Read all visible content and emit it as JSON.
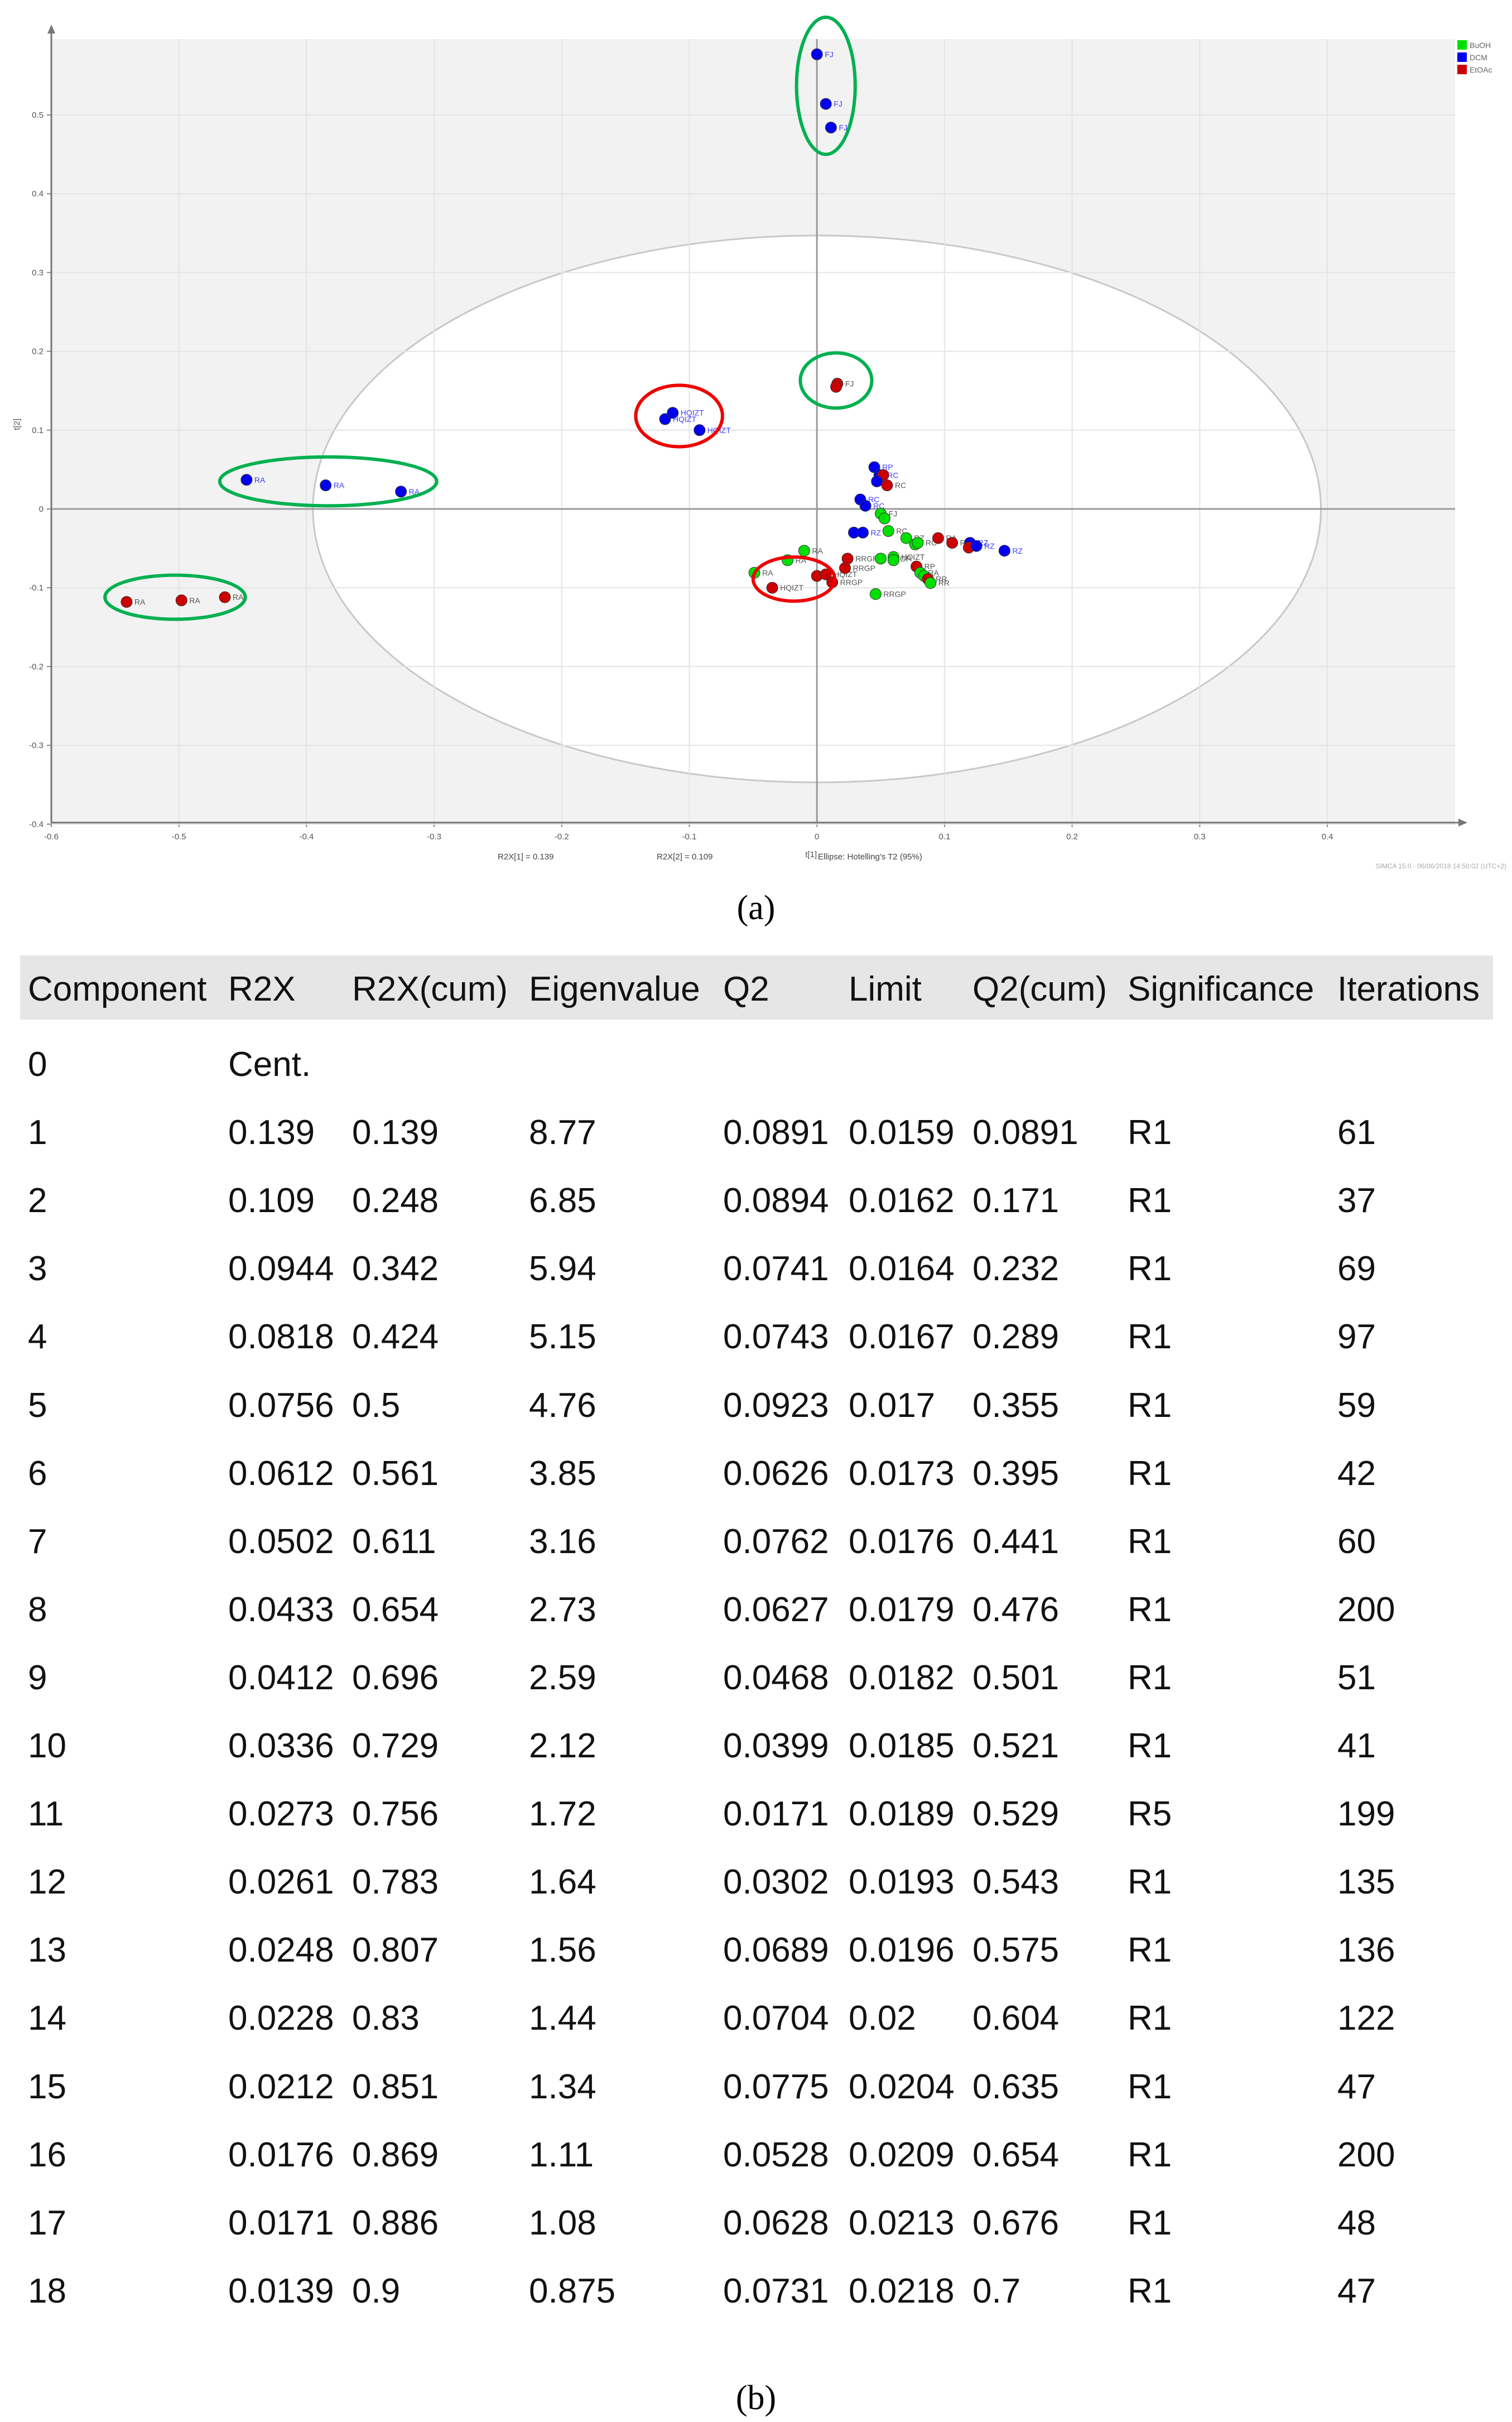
{
  "chart_data": {
    "type": "scatter",
    "title": "",
    "xlabel": "t[1]",
    "ylabel": "t[2]",
    "xlim": [
      -0.6,
      0.5
    ],
    "ylim": [
      -0.4,
      0.6
    ],
    "xticks": [
      -0.6,
      -0.5,
      -0.4,
      -0.3,
      -0.2,
      -0.1,
      0,
      0.1,
      0.2,
      0.3,
      0.4
    ],
    "xtick_labels": [
      "-0.6",
      "-0.5",
      "-0.4",
      "-0.3",
      "-0.2",
      "-0.1",
      "0",
      "0.1",
      "0.2",
      "0.3",
      "0.4"
    ],
    "yticks": [
      -0.4,
      -0.3,
      -0.2,
      -0.1,
      0,
      0.1,
      0.2,
      0.3,
      0.4,
      0.5
    ],
    "ytick_labels": [
      "-0.4",
      "-0.3",
      "-0.2",
      "-0.1",
      "0",
      "0.1",
      "0.2",
      "0.3",
      "0.4",
      "0.5"
    ],
    "grid": true,
    "legend_position": "top-right",
    "legend": [
      {
        "name": "BuOH",
        "color": "#00e000"
      },
      {
        "name": "DCM",
        "color": "#0000ee"
      },
      {
        "name": "EtOAc",
        "color": "#cc0000"
      }
    ],
    "hotelling_ellipse": {
      "cx": 0,
      "cy": 0,
      "rx": 0.395,
      "ry": 0.347
    },
    "annotation_ellipses": [
      {
        "cx": 0.007,
        "cy": 0.537,
        "rx": 0.023,
        "ry": 0.087,
        "color": "#00b050"
      },
      {
        "cx": -0.383,
        "cy": 0.035,
        "rx": 0.085,
        "ry": 0.031,
        "color": "#00b050"
      },
      {
        "cx": -0.503,
        "cy": -0.112,
        "rx": 0.055,
        "ry": 0.028,
        "color": "#00b050"
      },
      {
        "cx": -0.108,
        "cy": 0.118,
        "rx": 0.034,
        "ry": 0.039,
        "color": "#ee0000"
      },
      {
        "cx": 0.015,
        "cy": 0.163,
        "rx": 0.028,
        "ry": 0.035,
        "color": "#00b050"
      },
      {
        "cx": -0.018,
        "cy": -0.089,
        "rx": 0.032,
        "ry": 0.028,
        "color": "#ee0000"
      }
    ],
    "points": [
      {
        "x": 0.0,
        "y": 0.577,
        "g": "DCM",
        "label": "FJ"
      },
      {
        "x": 0.007,
        "y": 0.514,
        "g": "DCM",
        "label": "FJ"
      },
      {
        "x": 0.011,
        "y": 0.484,
        "g": "DCM",
        "label": "FJ"
      },
      {
        "x": -0.447,
        "y": 0.037,
        "g": "DCM",
        "label": "RA"
      },
      {
        "x": -0.385,
        "y": 0.03,
        "g": "DCM",
        "label": "RA"
      },
      {
        "x": -0.326,
        "y": 0.022,
        "g": "DCM",
        "label": "RA"
      },
      {
        "x": -0.541,
        "y": -0.118,
        "g": "EtOAc",
        "label": "RA"
      },
      {
        "x": -0.498,
        "y": -0.116,
        "g": "EtOAc",
        "label": "RA"
      },
      {
        "x": -0.464,
        "y": -0.112,
        "g": "EtOAc",
        "label": "RA"
      },
      {
        "x": -0.119,
        "y": 0.114,
        "g": "DCM",
        "label": "HQIZT"
      },
      {
        "x": -0.113,
        "y": 0.122,
        "g": "DCM",
        "label": "HQIZT"
      },
      {
        "x": -0.092,
        "y": 0.1,
        "g": "DCM",
        "label": "HQIZT"
      },
      {
        "x": 0.016,
        "y": 0.159,
        "g": "EtOAc",
        "label": "FJ"
      },
      {
        "x": 0.015,
        "y": 0.155,
        "g": "EtOAc",
        "label": ""
      },
      {
        "x": 0.045,
        "y": 0.053,
        "g": "DCM",
        "label": "RP"
      },
      {
        "x": 0.049,
        "y": 0.043,
        "g": "DCM",
        "label": "RC"
      },
      {
        "x": 0.052,
        "y": 0.043,
        "g": "EtOAc",
        "label": ""
      },
      {
        "x": 0.047,
        "y": 0.035,
        "g": "DCM",
        "label": ""
      },
      {
        "x": 0.055,
        "y": 0.03,
        "g": "EtOAc",
        "label": "RC"
      },
      {
        "x": 0.034,
        "y": 0.012,
        "g": "DCM",
        "label": "RC"
      },
      {
        "x": 0.038,
        "y": 0.004,
        "g": "DCM",
        "label": "RC"
      },
      {
        "x": 0.05,
        "y": -0.006,
        "g": "BuOH",
        "label": "FJ"
      },
      {
        "x": 0.053,
        "y": -0.012,
        "g": "BuOH",
        "label": ""
      },
      {
        "x": 0.029,
        "y": -0.03,
        "g": "DCM",
        "label": ""
      },
      {
        "x": 0.036,
        "y": -0.03,
        "g": "DCM",
        "label": "RZ"
      },
      {
        "x": 0.056,
        "y": -0.028,
        "g": "BuOH",
        "label": "RC"
      },
      {
        "x": 0.07,
        "y": -0.037,
        "g": "BuOH",
        "label": "RZ"
      },
      {
        "x": 0.077,
        "y": -0.045,
        "g": "BuOH",
        "label": ""
      },
      {
        "x": 0.079,
        "y": -0.043,
        "g": "BuOH",
        "label": "RC"
      },
      {
        "x": 0.095,
        "y": -0.037,
        "g": "EtOAc",
        "label": "RA"
      },
      {
        "x": 0.106,
        "y": -0.043,
        "g": "EtOAc",
        "label": "RZ"
      },
      {
        "x": 0.12,
        "y": -0.043,
        "g": "DCM",
        "label": "RZ"
      },
      {
        "x": 0.119,
        "y": -0.049,
        "g": "EtOAc",
        "label": ""
      },
      {
        "x": 0.125,
        "y": -0.047,
        "g": "DCM",
        "label": "RZ"
      },
      {
        "x": 0.147,
        "y": -0.053,
        "g": "DCM",
        "label": "RZ"
      },
      {
        "x": -0.01,
        "y": -0.053,
        "g": "BuOH",
        "label": "RA"
      },
      {
        "x": -0.023,
        "y": -0.065,
        "g": "BuOH",
        "label": "RA"
      },
      {
        "x": -0.049,
        "y": -0.081,
        "g": "BuOH",
        "label": "RA"
      },
      {
        "x": -0.035,
        "y": -0.1,
        "g": "EtOAc",
        "label": "HQIZT"
      },
      {
        "x": 0.0,
        "y": -0.085,
        "g": "EtOAc",
        "label": ""
      },
      {
        "x": 0.007,
        "y": -0.083,
        "g": "EtOAc",
        "label": "HQIZT"
      },
      {
        "x": 0.012,
        "y": -0.093,
        "g": "EtOAc",
        "label": "RRGP"
      },
      {
        "x": 0.022,
        "y": -0.075,
        "g": "EtOAc",
        "label": "RRGP"
      },
      {
        "x": 0.024,
        "y": -0.063,
        "g": "EtOAc",
        "label": "RRGP"
      },
      {
        "x": 0.05,
        "y": -0.063,
        "g": "BuOH",
        "label": "RRGP"
      },
      {
        "x": 0.06,
        "y": -0.061,
        "g": "BuOH",
        "label": "HQIZT"
      },
      {
        "x": 0.06,
        "y": -0.065,
        "g": "BuOH",
        "label": ""
      },
      {
        "x": 0.078,
        "y": -0.073,
        "g": "EtOAc",
        "label": "RP"
      },
      {
        "x": 0.081,
        "y": -0.081,
        "g": "BuOH",
        "label": "RA"
      },
      {
        "x": 0.084,
        "y": -0.085,
        "g": "BuOH",
        "label": ""
      },
      {
        "x": 0.087,
        "y": -0.089,
        "g": "EtOAc",
        "label": "RR"
      },
      {
        "x": 0.089,
        "y": -0.094,
        "g": "BuOH",
        "label": "RR"
      },
      {
        "x": 0.046,
        "y": -0.108,
        "g": "BuOH",
        "label": "RRGP"
      }
    ],
    "footer": {
      "r2x1": "R2X[1] = 0.139",
      "r2x2": "R2X[2] = 0.109",
      "ellipse": "Ellipse: Hotelling's T2 (95%)",
      "software": "SIMCA 15.0 - 06/06/2018 14:50:02 (UTC+2)"
    }
  },
  "captions": {
    "a": "(a)",
    "b": "(b)"
  },
  "table": {
    "columns": [
      "Component",
      "R2X",
      "R2X(cum)",
      "Eigenvalue",
      "Q2",
      "Limit",
      "Q2(cum)",
      "Significance",
      "Iterations"
    ],
    "rows": [
      [
        "0",
        "Cent.",
        "",
        "",
        "",
        "",
        "",
        "",
        ""
      ],
      [
        "1",
        "0.139",
        "0.139",
        "8.77",
        "0.0891",
        "0.0159",
        "0.0891",
        "R1",
        "61"
      ],
      [
        "2",
        "0.109",
        "0.248",
        "6.85",
        "0.0894",
        "0.0162",
        "0.171",
        "R1",
        "37"
      ],
      [
        "3",
        "0.0944",
        "0.342",
        "5.94",
        "0.0741",
        "0.0164",
        "0.232",
        "R1",
        "69"
      ],
      [
        "4",
        "0.0818",
        "0.424",
        "5.15",
        "0.0743",
        "0.0167",
        "0.289",
        "R1",
        "97"
      ],
      [
        "5",
        "0.0756",
        "0.5",
        "4.76",
        "0.0923",
        "0.017",
        "0.355",
        "R1",
        "59"
      ],
      [
        "6",
        "0.0612",
        "0.561",
        "3.85",
        "0.0626",
        "0.0173",
        "0.395",
        "R1",
        "42"
      ],
      [
        "7",
        "0.0502",
        "0.611",
        "3.16",
        "0.0762",
        "0.0176",
        "0.441",
        "R1",
        "60"
      ],
      [
        "8",
        "0.0433",
        "0.654",
        "2.73",
        "0.0627",
        "0.0179",
        "0.476",
        "R1",
        "200"
      ],
      [
        "9",
        "0.0412",
        "0.696",
        "2.59",
        "0.0468",
        "0.0182",
        "0.501",
        "R1",
        "51"
      ],
      [
        "10",
        "0.0336",
        "0.729",
        "2.12",
        "0.0399",
        "0.0185",
        "0.521",
        "R1",
        "41"
      ],
      [
        "11",
        "0.0273",
        "0.756",
        "1.72",
        "0.0171",
        "0.0189",
        "0.529",
        "R5",
        "199"
      ],
      [
        "12",
        "0.0261",
        "0.783",
        "1.64",
        "0.0302",
        "0.0193",
        "0.543",
        "R1",
        "135"
      ],
      [
        "13",
        "0.0248",
        "0.807",
        "1.56",
        "0.0689",
        "0.0196",
        "0.575",
        "R1",
        "136"
      ],
      [
        "14",
        "0.0228",
        "0.83",
        "1.44",
        "0.0704",
        "0.02",
        "0.604",
        "R1",
        "122"
      ],
      [
        "15",
        "0.0212",
        "0.851",
        "1.34",
        "0.0775",
        "0.0204",
        "0.635",
        "R1",
        "47"
      ],
      [
        "16",
        "0.0176",
        "0.869",
        "1.11",
        "0.0528",
        "0.0209",
        "0.654",
        "R1",
        "200"
      ],
      [
        "17",
        "0.0171",
        "0.886",
        "1.08",
        "0.0628",
        "0.0213",
        "0.676",
        "R1",
        "48"
      ],
      [
        "18",
        "0.0139",
        "0.9",
        "0.875",
        "0.0731",
        "0.0218",
        "0.7",
        "R1",
        "47"
      ]
    ]
  }
}
